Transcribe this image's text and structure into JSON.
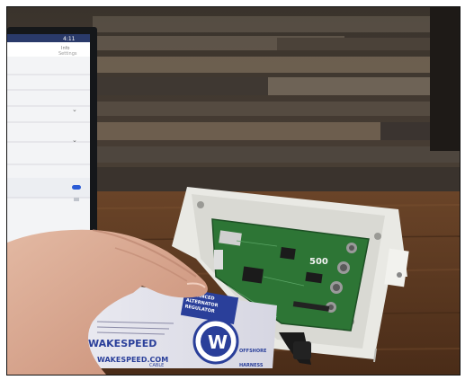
{
  "photo": {
    "tablet": {
      "status_text": "4:11",
      "header_text": "Info",
      "header_sub": "Settings"
    },
    "board": {
      "chip_label": "500"
    },
    "label_card": {
      "brand": "WAKESPEED",
      "url": "WAKESPEED.COM",
      "logo_letter": "W",
      "offshore": "OFFSHORE",
      "lines": [
        "ADVANCED",
        "ALTERNATOR",
        "REGULATOR"
      ],
      "harness": "HARNESS",
      "cable": "CABLE"
    },
    "colors": {
      "wall_dark": "#2a2520",
      "wood": "#5a3b24",
      "pcb": "#2f7a3a",
      "enclosure": "#eeeeea",
      "label_blue": "#2a3f9a"
    }
  }
}
